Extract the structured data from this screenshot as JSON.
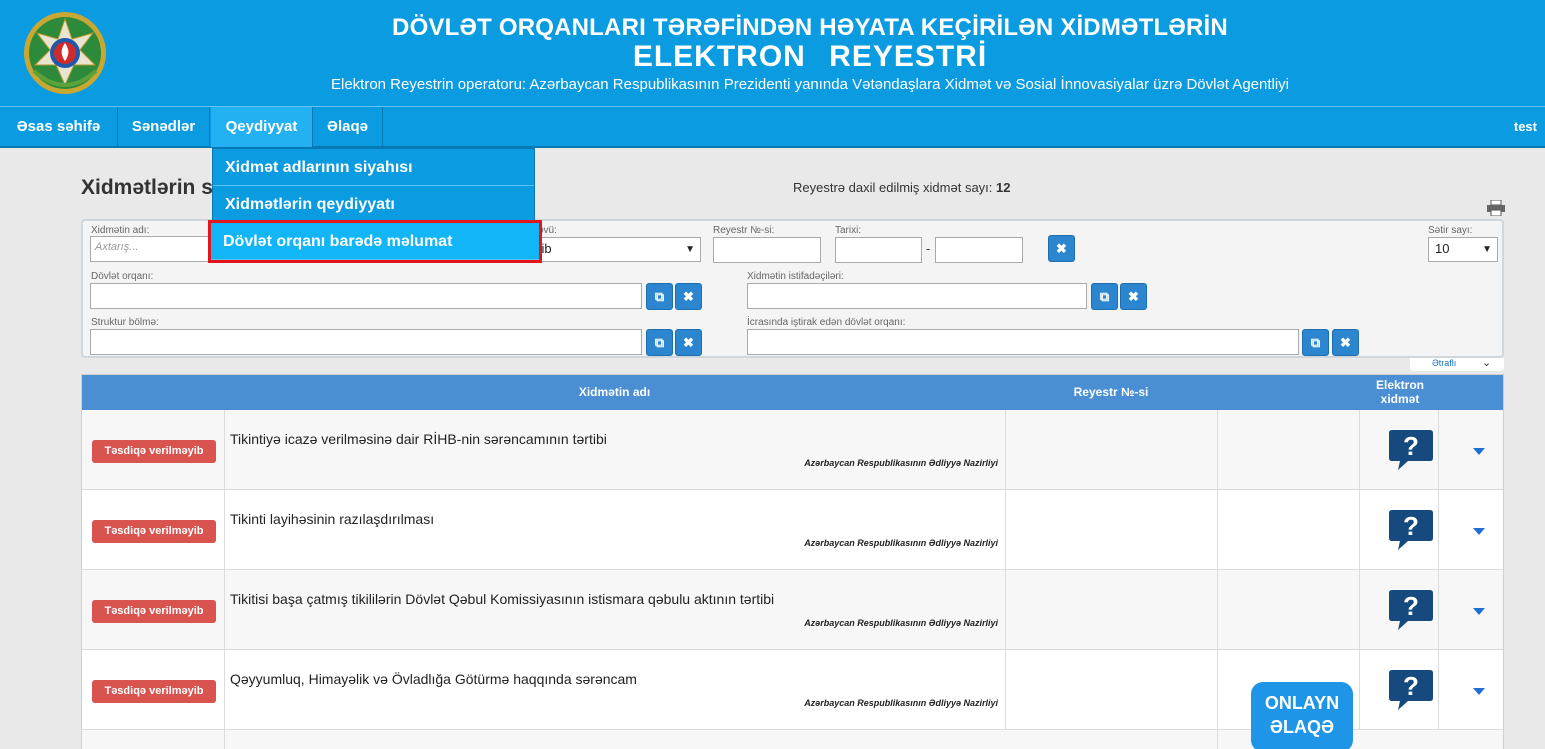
{
  "header": {
    "title_line1": "DÖVLƏT ORQANLARI TƏRƏFİNDƏN HƏYATA KEÇİRİLƏN XİDMƏTLƏRİN",
    "title_line2": "ELEKTRON   REYESTRİ",
    "subtitle": "Elektron Reyestrin operatoru: Azərbaycan Respublikasının Prezidenti yanında Vətəndaşlara Xidmət və Sosial İnnovasiyalar üzrə Dövlət Agentliyi",
    "emblem_icon": "azerbaijan-emblem-icon"
  },
  "nav": {
    "items": [
      {
        "label": "Əsas səhifə"
      },
      {
        "label": "Sənədlər"
      },
      {
        "label": "Qeydiyyat",
        "active": true
      },
      {
        "label": "Əlaqə"
      }
    ],
    "user": "test"
  },
  "dropdown": {
    "items": [
      {
        "label": "Xidmət adlarının siyahısı"
      },
      {
        "label": "Xidmətlərin qeydiyyatı"
      },
      {
        "label": "Dövlət orqanı barədə məlumat",
        "highlighted": true
      }
    ]
  },
  "main": {
    "title": "Xidmətlərin s",
    "count_label": "Reyestrə daxil edilmiş xidmət sayı:",
    "count_value": "12",
    "print_icon": "print-icon"
  },
  "filters": {
    "service_name_label": "Xidmətin adı:",
    "service_name_placeholder": "Axtarış...",
    "type_label": "övü:",
    "type_value": "yib",
    "registry_no_label": "Reyestr №-si:",
    "date_label": "Tarixi:",
    "date_sep": "-",
    "rows_label": "Sətir sayı:",
    "rows_value": "10",
    "gov_org_label": "Dövlət orqanı:",
    "users_label": "Xidmətin istifadəçiləri:",
    "struct_label": "Struktur bölmə:",
    "participating_org_label": "İcrasında iştirak edən dövlət orqanı:",
    "more_label": "Ətraflı"
  },
  "table": {
    "headers": {
      "name": "Xidmətin adı",
      "registry_no": "Reyestr №-si",
      "electronic_line1": "Elektron",
      "electronic_line2": "xidmət"
    },
    "rows": [
      {
        "status": "Təsdiqə verilməyib",
        "service": "Tikintiyə icazə verilməsinə dair RİHB-nin sərəncamının tərtibi",
        "org": "Azərbaycan Respublikasının Ədliyyə Nazirliyi"
      },
      {
        "status": "Təsdiqə verilməyib",
        "service": "Tikinti layihəsinin razılaşdırılması",
        "org": "Azərbaycan Respublikasının Ədliyyə Nazirliyi"
      },
      {
        "status": "Təsdiqə verilməyib",
        "service": "Tikitisi başa çatmış tikililərin Dövlət Qəbul Komissiyasının istismara qəbulu aktının tərtibi",
        "org": "Azərbaycan Respublikasının Ədliyyə Nazirliyi"
      },
      {
        "status": "Təsdiqə verilməyib",
        "service": "Qəyyumluq, Himayəlik və Övladlığa Götürmə haqqında sərəncam",
        "org": "Azərbaycan Respublikasının Ədliyyə Nazirliyi"
      }
    ]
  },
  "online_chat": {
    "line1": "ONLAYN",
    "line2": "ƏLAQƏ"
  },
  "colors": {
    "header_blue": "#0a9be0",
    "badge_red": "#d9534f",
    "table_header": "#4a8fd4",
    "highlight_border": "#e2141d"
  }
}
